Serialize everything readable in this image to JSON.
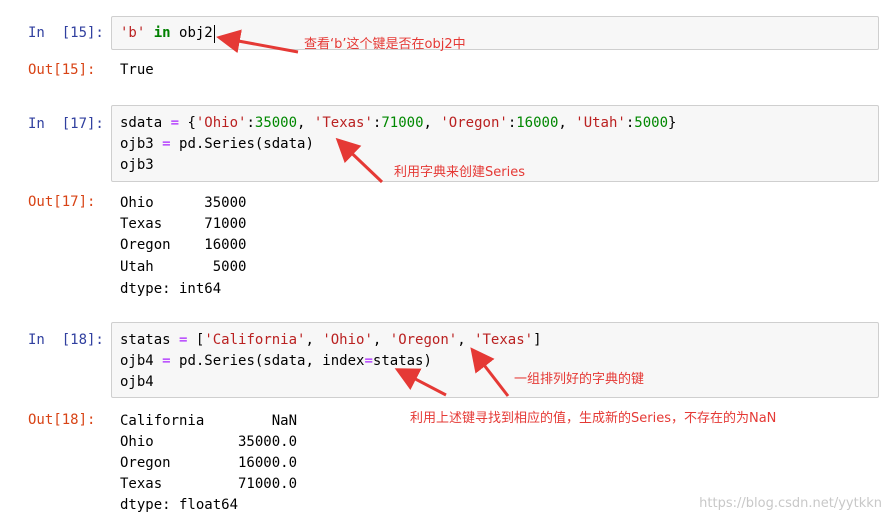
{
  "cells": [
    {
      "in_prompt": "In  [15]:",
      "out_prompt": "Out[15]:",
      "code": [
        "'b' in obj2"
      ],
      "output": [
        "True"
      ]
    },
    {
      "in_prompt": "In  [17]:",
      "out_prompt": "Out[17]:",
      "code": [
        "sdata = {'Ohio':35000, 'Texas':71000, 'Oregon':16000, 'Utah':5000}",
        "ojb3 = pd.Series(sdata)",
        "ojb3"
      ],
      "output": [
        "Ohio      35000",
        "Texas     71000",
        "Oregon    16000",
        "Utah       5000",
        "dtype: int64"
      ]
    },
    {
      "in_prompt": "In  [18]:",
      "out_prompt": "Out[18]:",
      "code": [
        "statas = ['California', 'Ohio', 'Oregon', 'Texas']",
        "ojb4 = pd.Series(sdata, index=statas)",
        "ojb4"
      ],
      "output": [
        "California        NaN",
        "Ohio          35000.0",
        "Oregon        16000.0",
        "Texas         71000.0",
        "dtype: float64"
      ]
    }
  ],
  "annotations": {
    "a1": "查看‘b’这个键是否在obj2中",
    "a2": "利用字典来创建Series",
    "a3": "一组排列好的字典的键",
    "a4": "利用上述键寻找到相应的值，生成新的Series，不存在的为NaN"
  },
  "colors": {
    "annotation": "#e53935",
    "in_prompt": "#303f9f",
    "out_prompt": "#d84315",
    "string": "#ba2121",
    "keyword": "#008000"
  },
  "watermark": "https://blog.csdn.net/yytkkn"
}
